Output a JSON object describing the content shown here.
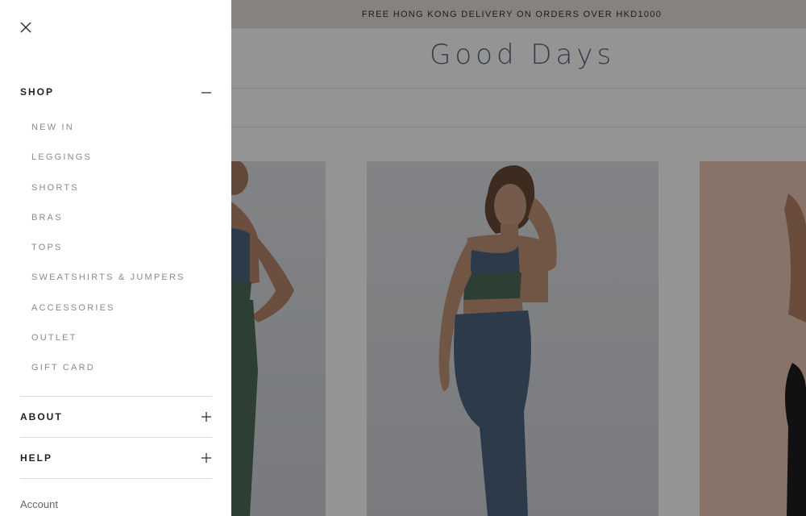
{
  "announcement": "FREE HONG KONG DELIVERY ON ORDERS OVER HKD1000",
  "brand": {
    "logo_text": "Good Days"
  },
  "drawer": {
    "close_icon": "close-icon",
    "shop": {
      "label": "SHOP",
      "toggle_icon": "minus-icon",
      "items": [
        {
          "label": "NEW IN"
        },
        {
          "label": "LEGGINGS"
        },
        {
          "label": "SHORTS"
        },
        {
          "label": "BRAS"
        },
        {
          "label": "TOPS"
        },
        {
          "label": "SWEATSHIRTS & JUMPERS"
        },
        {
          "label": "ACCESSORIES"
        },
        {
          "label": "OUTLET"
        },
        {
          "label": "GIFT CARD"
        }
      ]
    },
    "about": {
      "label": "ABOUT",
      "toggle_icon": "plus-icon"
    },
    "help": {
      "label": "HELP",
      "toggle_icon": "plus-icon"
    },
    "account_label": "Account"
  },
  "colors": {
    "accent": "#5a6a7e",
    "legging_blue": "#4d6580",
    "legging_green": "#4f6b5a"
  }
}
